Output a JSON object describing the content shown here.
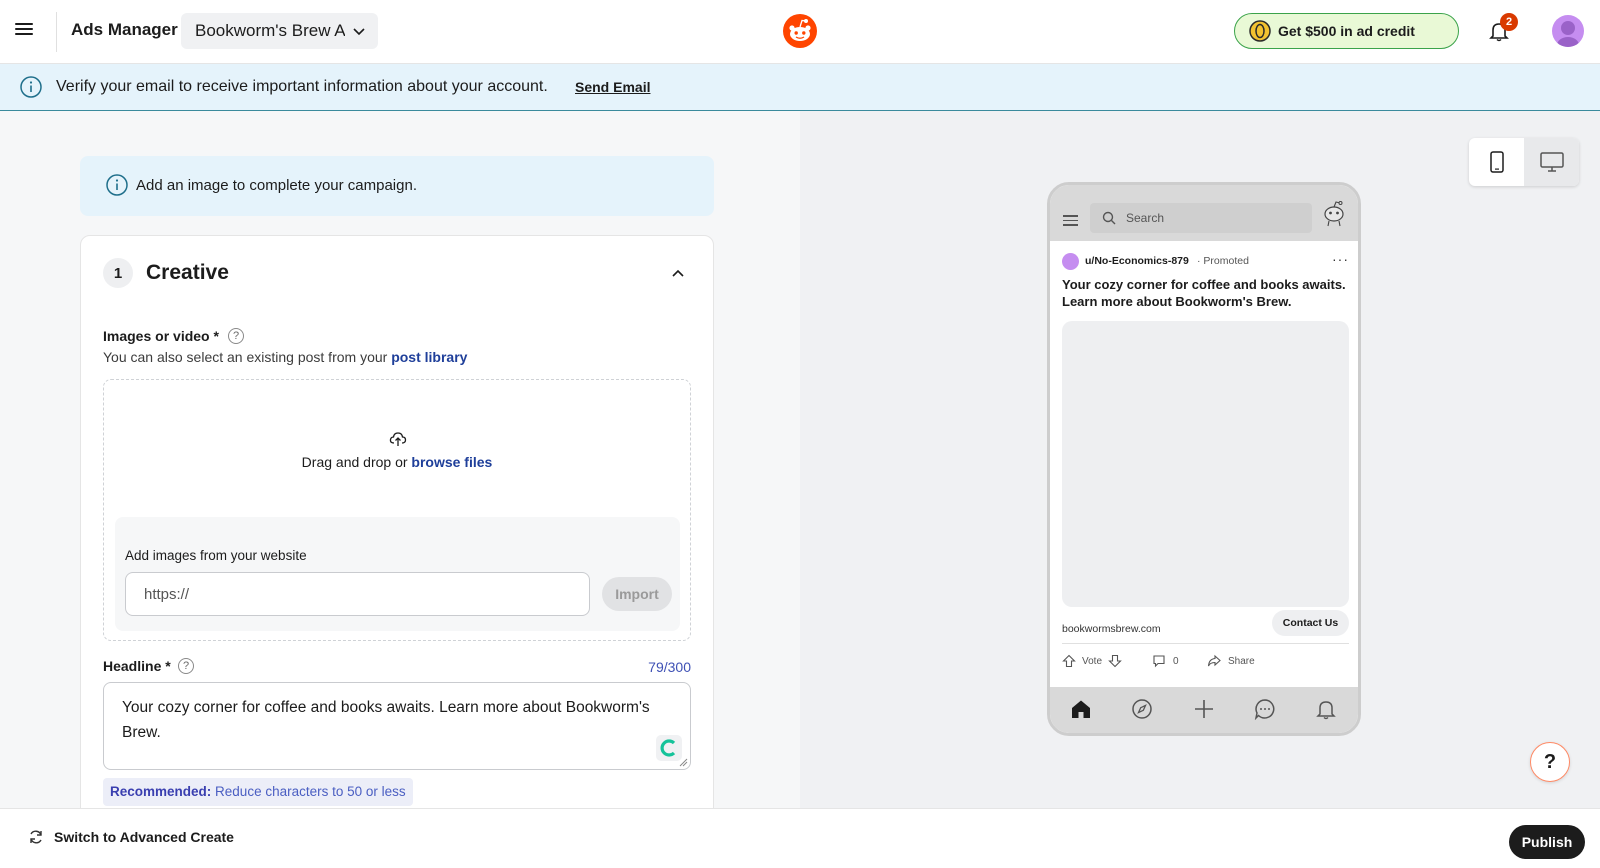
{
  "header": {
    "app_title": "Ads Manager",
    "account_name": "Bookworm's Brew Ads",
    "ad_credit_label": "Get $500 in ad credit",
    "notification_count": "2"
  },
  "banner": {
    "message": "Verify your email to receive important information about your account.",
    "link": "Send Email"
  },
  "notice": {
    "text": "Add an image to complete your campaign."
  },
  "creative": {
    "step": "1",
    "title": "Creative",
    "images_label": "Images or video *",
    "help": "?",
    "existing_prefix": "You can also select an existing post from your",
    "existing_link": "post library",
    "drop_prefix": "Drag and drop or",
    "drop_link": "browse files",
    "website_label": "Add images from your website",
    "url_placeholder": "https://",
    "import_label": "Import",
    "headline_label": "Headline *",
    "headline_count": "79/300",
    "headline_value": "Your cozy corner for coffee and books awaits. Learn more about Bookworm's Brew.",
    "recommend_prefix": "Recommended:",
    "recommend_text": "Reduce characters to 50 or less"
  },
  "preview": {
    "search_placeholder": "Search",
    "username": "u/No-Economics-879",
    "promoted": "· Promoted",
    "more": "···",
    "post_title": "Your cozy corner for coffee and books awaits. Learn more about Bookworm's Brew.",
    "domain": "bookwormsbrew.com",
    "cta": "Contact Us",
    "vote": "Vote",
    "comments": "0",
    "share": "Share"
  },
  "help_fab": "?",
  "footer": {
    "switch_label": "Switch to Advanced Create",
    "publish_label": "Publish"
  },
  "colors": {
    "brand": "#ff4500",
    "credit_bg": "#e9f9d6",
    "credit_border": "#3ba34a",
    "banner_bg": "#e5f3fb",
    "link": "#1f3f9a",
    "count": "#3f51b5",
    "badge": "#d93a00"
  },
  "icons": [
    "menu-icon",
    "chevron-down-icon",
    "reddit-logo-icon",
    "coin-icon",
    "bell-icon",
    "avatar",
    "info-icon",
    "chevron-up-icon",
    "help-icon",
    "upload-icon",
    "mobile-icon",
    "desktop-icon",
    "search-icon",
    "home-icon",
    "compass-icon",
    "plus-icon",
    "chat-icon",
    "refresh-icon"
  ]
}
